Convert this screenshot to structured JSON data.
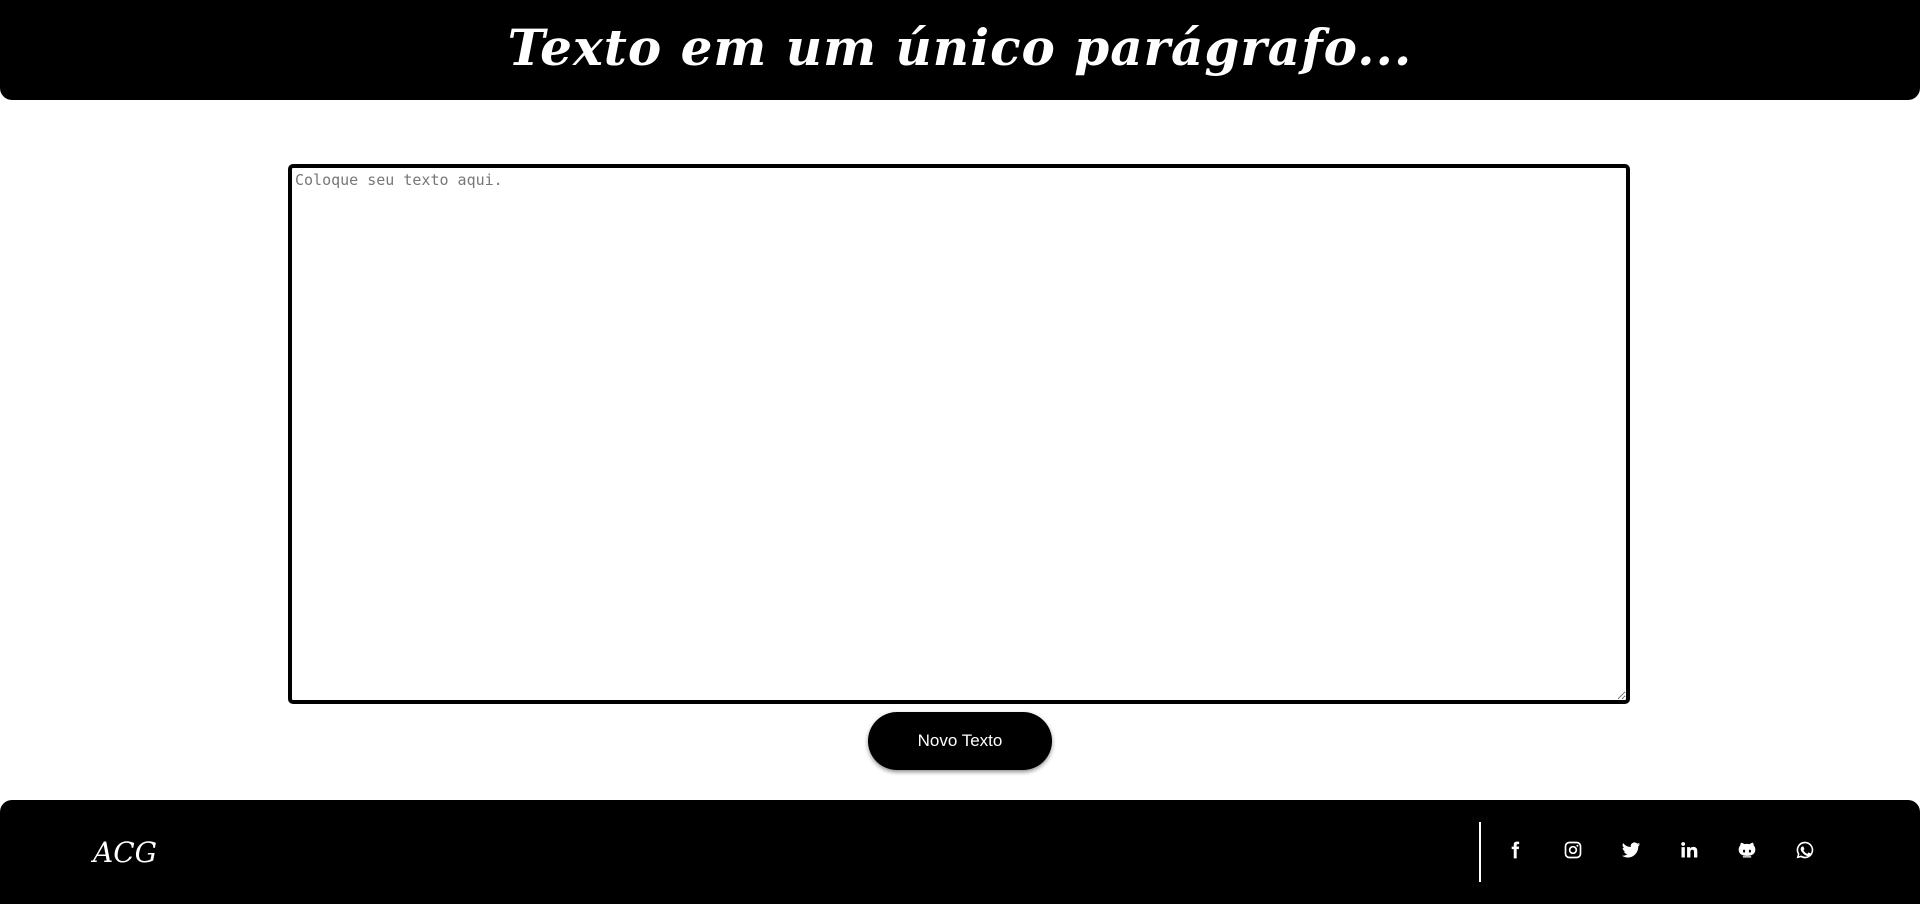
{
  "header": {
    "title": "Texto em um único parágrafo..."
  },
  "editor": {
    "placeholder": "Coloque seu texto aqui.",
    "value": ""
  },
  "actions": {
    "new_text_label": "Novo Texto"
  },
  "footer": {
    "brand": "ACG",
    "social": [
      {
        "name": "facebook",
        "icon": "facebook-icon"
      },
      {
        "name": "instagram",
        "icon": "instagram-icon"
      },
      {
        "name": "twitter",
        "icon": "twitter-icon"
      },
      {
        "name": "linkedin",
        "icon": "linkedin-icon"
      },
      {
        "name": "github",
        "icon": "github-icon"
      },
      {
        "name": "whatsapp",
        "icon": "whatsapp-icon"
      }
    ]
  },
  "colors": {
    "primary": "#000000",
    "background": "#ffffff",
    "text_on_primary": "#ffffff",
    "placeholder": "#777777"
  }
}
